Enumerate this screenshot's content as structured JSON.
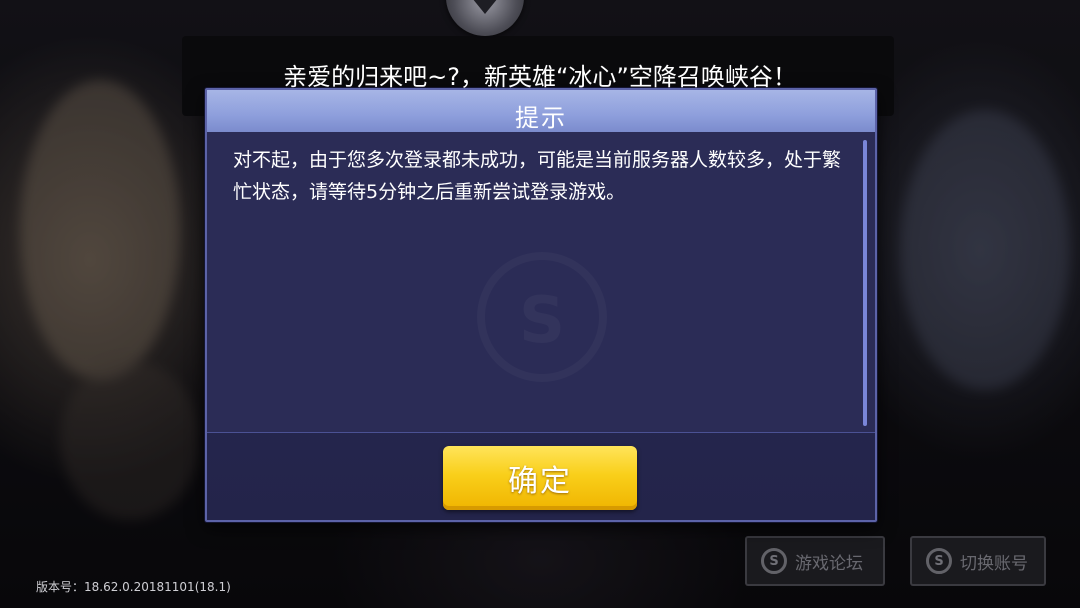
{
  "top_notice": {
    "text": "亲爱的归来吧~?，新英雄“冰心”空降召唤峡谷！"
  },
  "dialog": {
    "title": "提示",
    "message": "对不起，由于您多次登录都未成功，可能是当前服务器人数较多，处于繁忙状态，请等待5分钟之后重新尝试登录游戏。",
    "confirm_label": "确定"
  },
  "background_buttons": {
    "forum_label": "游戏论坛",
    "switch_account_label": "切换账号",
    "icon_glyph": "S"
  },
  "footer": {
    "version": "版本号：18.62.0.20181101(18.1)"
  },
  "icons": {
    "top_emblem": "down-arrow-emblem-icon",
    "watermark": "s-logo-icon",
    "forum_icon": "s-logo-icon",
    "switch_icon": "s-logo-icon"
  },
  "colors": {
    "dialog_bg": "#2b2c56",
    "dialog_border": "#5c63a8",
    "header": "#8e9fdc",
    "confirm_button": "#f9cf1a"
  }
}
